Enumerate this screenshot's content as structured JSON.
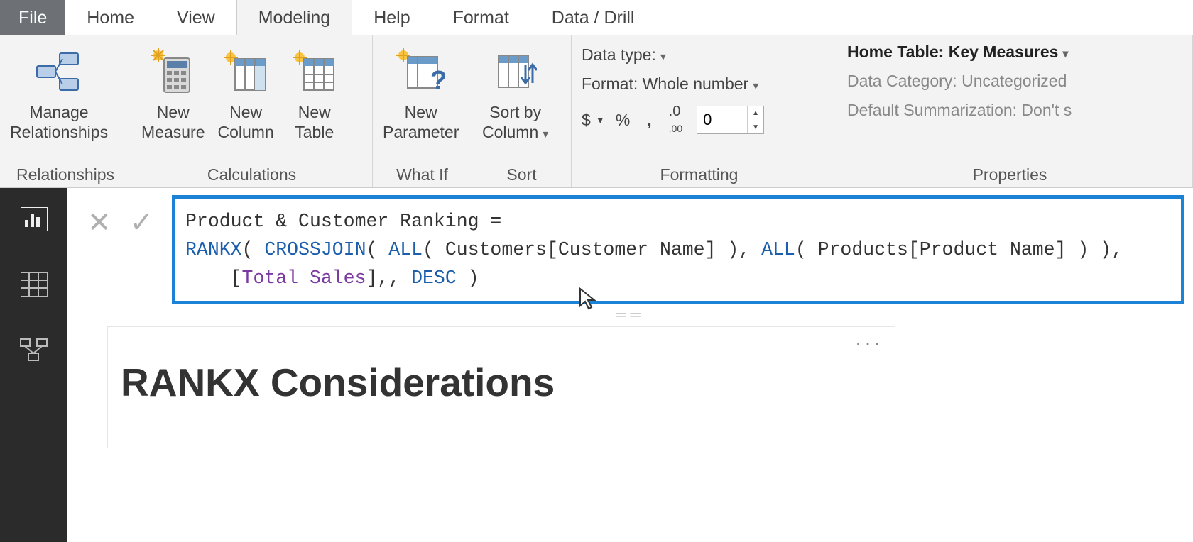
{
  "menu": {
    "file": "File",
    "home": "Home",
    "view": "View",
    "modeling": "Modeling",
    "help": "Help",
    "format": "Format",
    "datadrill": "Data / Drill"
  },
  "ribbon": {
    "relationships": {
      "manage": "Manage\nRelationships",
      "group": "Relationships"
    },
    "calculations": {
      "newMeasure": "New\nMeasure",
      "newColumn": "New\nColumn",
      "newTable": "New\nTable",
      "group": "Calculations"
    },
    "whatif": {
      "newParameter": "New\nParameter",
      "group": "What If"
    },
    "sort": {
      "sortBy": "Sort by\nColumn",
      "group": "Sort"
    },
    "formatting": {
      "dataType": "Data type:",
      "format": "Format: Whole number",
      "currency": "$",
      "percent": "%",
      "comma": ",",
      "decimals": ".00",
      "decimalValue": "0",
      "group": "Formatting"
    },
    "properties": {
      "homeTable": "Home Table: Key Measures",
      "dataCategory": "Data Category: Uncategorized",
      "defaultSumm": "Default Summarization: Don't s",
      "group": "Properties"
    }
  },
  "formula": {
    "line1_part1": "Product & Customer Ranking =",
    "fn_rankx": "RANKX",
    "p1": "( ",
    "fn_crossjoin": "CROSSJOIN",
    "p2": "( ",
    "fn_all1": "ALL",
    "p3": "( Customers[Customer Name] ), ",
    "fn_all2": "ALL",
    "p4": "( Products[Product Name] ) ),",
    "indent": "    [",
    "id_total": "Total Sales",
    "p5": "],, ",
    "kw_desc": "DESC",
    "p6": " )"
  },
  "visual": {
    "title": "RANKX Considerations",
    "more": "···"
  }
}
